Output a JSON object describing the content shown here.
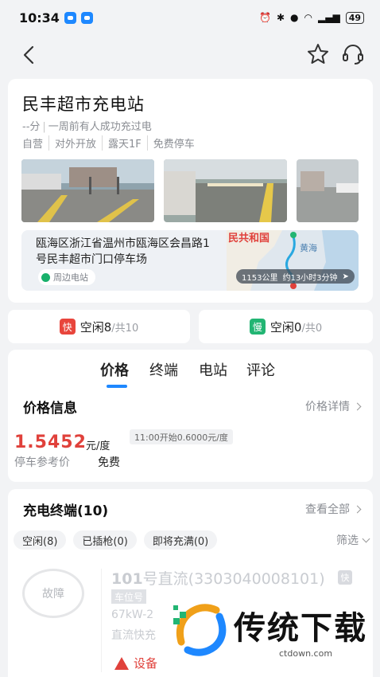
{
  "status_bar": {
    "time": "10:34",
    "battery": "49"
  },
  "station": {
    "name": "民丰超市充电站",
    "rating": "--分",
    "recent": "一周前有人成功充过电",
    "tags": [
      "自营",
      "对外开放",
      "露天1F",
      "免费停车"
    ],
    "address": "瓯海区浙江省温州市瓯海区会昌路1号民丰超市门口停车场",
    "nearby_label": "周边电站",
    "map_text_country": "民共和国",
    "map_text_sea": "黄海",
    "distance": "1153公里",
    "duration": "约13小时3分钟"
  },
  "availability": {
    "fast": {
      "badge": "快",
      "label": "空闲8",
      "total": "/共10",
      "color": "#e8453c"
    },
    "slow": {
      "badge": "慢",
      "label": "空闲0",
      "total": "/共0",
      "color": "#22b573"
    }
  },
  "tabs": [
    "价格",
    "终端",
    "电站",
    "评论"
  ],
  "price_info": {
    "title": "价格信息",
    "detail_link": "价格详情",
    "price": "1.5452",
    "unit": "元/度",
    "note": "11:00开始0.6000元/度",
    "parking_label": "停车参考价",
    "parking_value": "免费"
  },
  "terminals": {
    "title": "充电终端(10)",
    "view_all": "查看全部",
    "filters": [
      "空闲(8)",
      "已插枪(0)",
      "即将充满(0)"
    ],
    "filter_label": "筛选",
    "item": {
      "status": "故障",
      "name_num": "101",
      "name_rest": "号直流(3303040008101)",
      "fast_badge": "快",
      "position_tag": "车位号",
      "power": "67kW-2",
      "type": "直流快充",
      "warning": "设备"
    }
  },
  "watermark": {
    "title": "传统下载",
    "url": "ctdown.com"
  },
  "colors": {
    "accent": "#1e88ff",
    "price": "#e0413b"
  }
}
